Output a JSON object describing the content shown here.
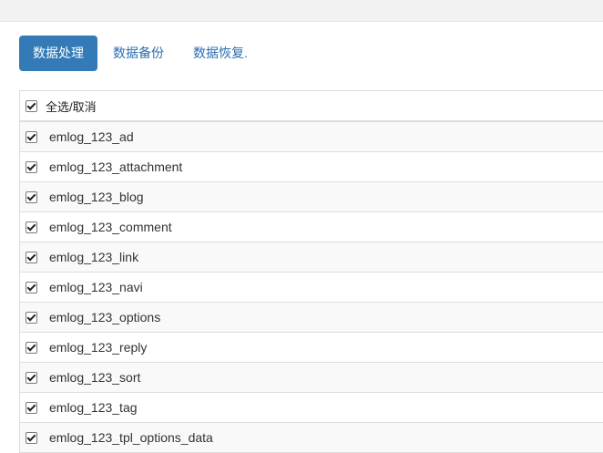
{
  "tabs": [
    {
      "label": "数据处理",
      "active": true
    },
    {
      "label": "数据备份",
      "active": false
    },
    {
      "label": "数据恢复.",
      "active": false
    }
  ],
  "table": {
    "select_all_label": "全选/取消",
    "select_all_checked": true,
    "rows": [
      {
        "name": "emlog_123_ad",
        "checked": true
      },
      {
        "name": "emlog_123_attachment",
        "checked": true
      },
      {
        "name": "emlog_123_blog",
        "checked": true
      },
      {
        "name": "emlog_123_comment",
        "checked": true
      },
      {
        "name": "emlog_123_link",
        "checked": true
      },
      {
        "name": "emlog_123_navi",
        "checked": true
      },
      {
        "name": "emlog_123_options",
        "checked": true
      },
      {
        "name": "emlog_123_reply",
        "checked": true
      },
      {
        "name": "emlog_123_sort",
        "checked": true
      },
      {
        "name": "emlog_123_tag",
        "checked": true
      },
      {
        "name": "emlog_123_tpl_options_data",
        "checked": true
      }
    ]
  },
  "colors": {
    "accent": "#337ab7",
    "link": "#2b6eb0",
    "row_stripe": "#f9f9f9",
    "border": "#dddddd"
  }
}
